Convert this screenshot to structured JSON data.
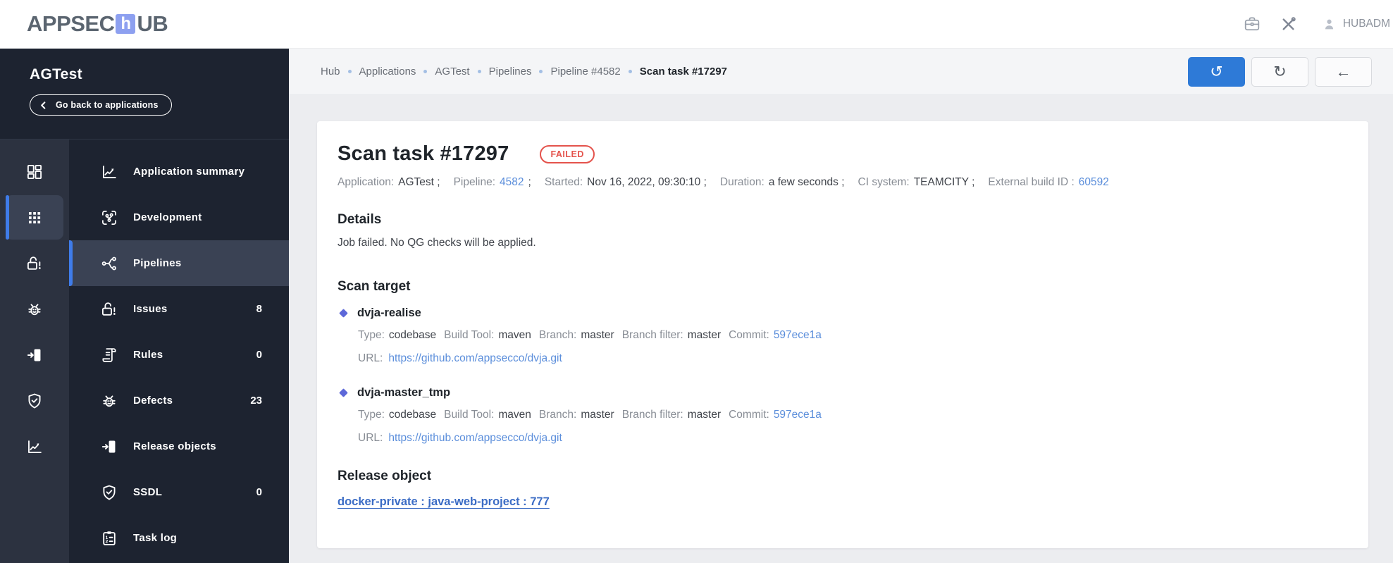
{
  "header": {
    "logo_part1": "APPSEC",
    "logo_tile": "h",
    "logo_part2": "UB",
    "username": "HUBADM"
  },
  "toolbar": {
    "restart_icon": "↺",
    "refresh_icon": "↻",
    "back_icon": "←"
  },
  "breadcrumb": {
    "items": [
      "Hub",
      "Applications",
      "AGTest",
      "Pipelines",
      "Pipeline #4582"
    ],
    "current": "Scan task #17297"
  },
  "sidebar": {
    "app_name": "AGTest",
    "back_label": "Go back to applications",
    "menu": [
      {
        "label": "Application summary"
      },
      {
        "label": "Development"
      },
      {
        "label": "Pipelines"
      },
      {
        "label": "Issues",
        "badge": "8"
      },
      {
        "label": "Rules",
        "badge": "0"
      },
      {
        "label": "Defects",
        "badge": "23"
      },
      {
        "label": "Release objects"
      },
      {
        "label": "SSDL",
        "badge": "0"
      },
      {
        "label": "Task log"
      }
    ]
  },
  "page": {
    "title": "Scan task #17297",
    "status_badge": "FAILED",
    "meta": {
      "application_label": "Application:",
      "application_value": "AGTest ;",
      "pipeline_label": "Pipeline:",
      "pipeline_link": "4582",
      "pipeline_suffix": ";",
      "started_label": "Started:",
      "started_value": "Nov 16, 2022, 09:30:10 ;",
      "duration_label": "Duration:",
      "duration_value": "a few seconds ;",
      "ci_label": "CI system:",
      "ci_value": "TEAMCITY ;",
      "build_label": "External build ID :",
      "build_link": "60592"
    },
    "details": {
      "heading": "Details",
      "text": "Job failed. No QG checks will be applied."
    },
    "scan_target": {
      "heading": "Scan target",
      "labels": {
        "type": "Type:",
        "build_tool": "Build Tool:",
        "branch": "Branch:",
        "branch_filter": "Branch filter:",
        "commit": "Commit:",
        "url": "URL:"
      },
      "targets": [
        {
          "name": "dvja-realise",
          "type": "codebase",
          "build_tool": "maven",
          "branch": "master",
          "branch_filter": "master",
          "commit": "597ece1a",
          "url": "https://github.com/appsecco/dvja.git"
        },
        {
          "name": "dvja-master_tmp",
          "type": "codebase",
          "build_tool": "maven",
          "branch": "master",
          "branch_filter": "master",
          "commit": "597ece1a",
          "url": "https://github.com/appsecco/dvja.git"
        }
      ]
    },
    "release_object": {
      "heading": "Release object",
      "link": "docker-private : java-web-project : 777"
    }
  },
  "colors": {
    "accent_blue": "#2e7ad7",
    "sidebar_accent": "#3f7cea",
    "failed_red": "#e4534c",
    "link_blue": "#5b8edb",
    "release_link_blue": "#3b6cc5",
    "bullet_indigo": "#5d68d9",
    "logo_tile": "#8da0f0",
    "sidebar_bg": "#1d2330",
    "rail_bg": "#2c3240",
    "selected_bg": "#3a4254"
  }
}
